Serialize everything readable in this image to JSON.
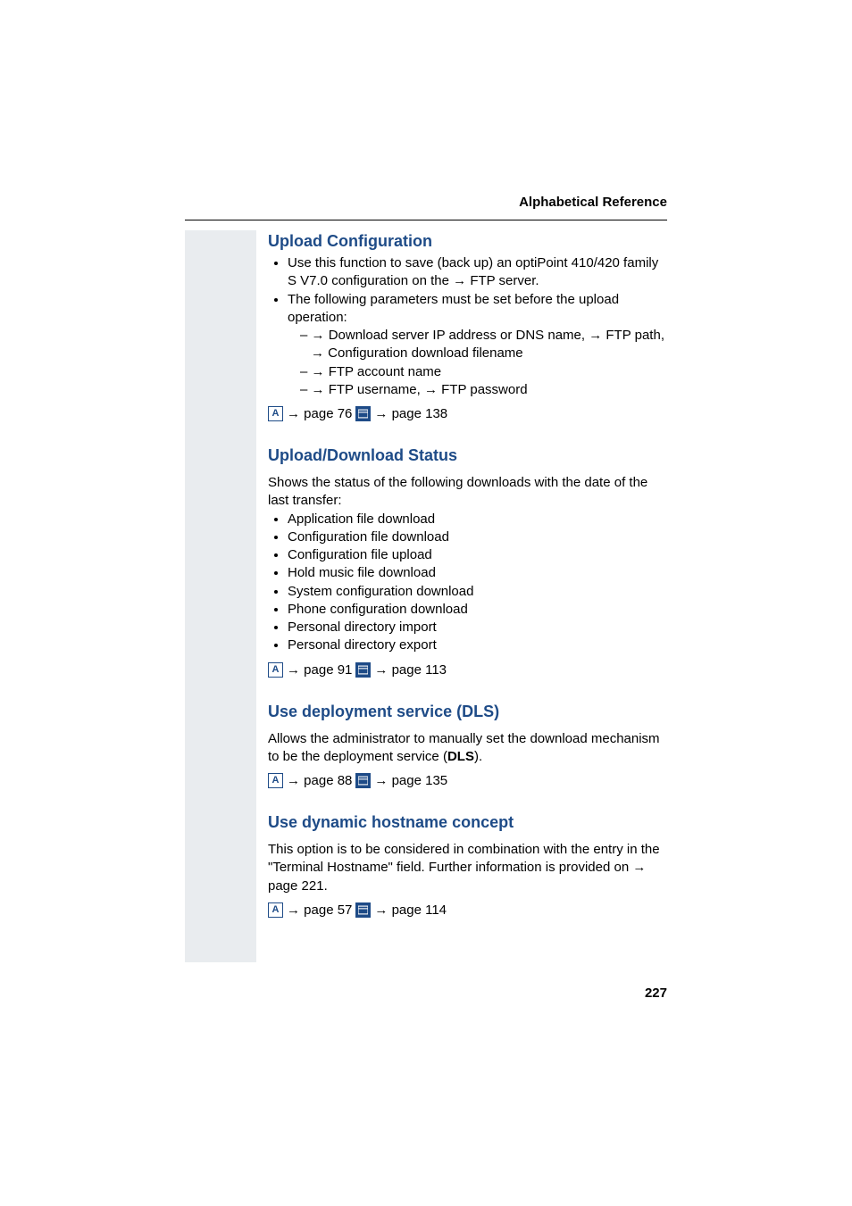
{
  "header": "Alphabetical Reference",
  "page_number": "227",
  "s1": {
    "heading": "Upload Configuration",
    "b1a": "Use this function to save (back up) an optiPoint 410/420 family S V7.0 configuration on the ",
    "b1link": "FTP server",
    "b1c": ".",
    "b2": "The following parameters must be set before the upload operation:",
    "sub1a": "Download server IP address or DNS name",
    "sub1b": "FTP path",
    "sub1c": "Configuration download filename",
    "sub2": "FTP account name",
    "sub3a": "FTP username",
    "sub3b": "FTP password",
    "link1": "page 76",
    "link2": "page 138"
  },
  "s2": {
    "heading": "Upload/Download Status",
    "intro": "Shows the status of the following downloads with the date of the last transfer:",
    "items": [
      "Application file download",
      "Configuration file download",
      "Configuration file upload",
      "Hold music file download",
      "System configuration download",
      "Phone configuration download",
      "Personal directory import",
      "Personal directory export"
    ],
    "link1": "page 91",
    "link2": "page 113"
  },
  "s3": {
    "heading": "Use deployment service (DLS)",
    "text_a": "Allows the administrator to manually set the download mechanism to be the deployment service (",
    "text_b": "DLS",
    "text_c": ").",
    "link1": "page 88",
    "link2": "page 135"
  },
  "s4": {
    "heading": "Use dynamic hostname concept",
    "text_a": "This option is to be considered in combination with the entry in the \"Terminal Hostname\" field. Further information is provided on ",
    "text_b": "page 221",
    "text_c": ".",
    "link1": "page 57",
    "link2": "page 114"
  }
}
